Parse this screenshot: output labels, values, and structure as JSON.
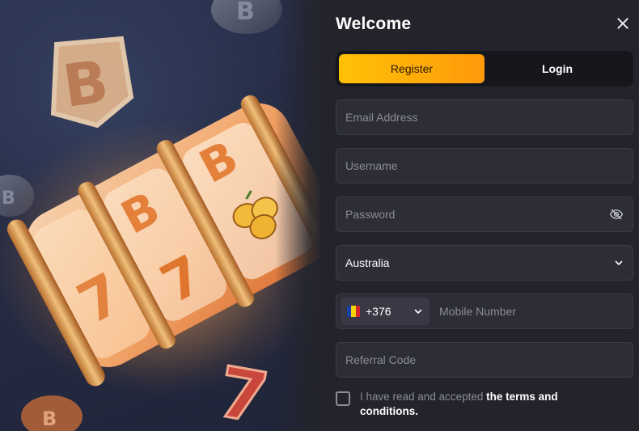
{
  "panel": {
    "title": "Welcome",
    "close_icon": "close-icon"
  },
  "tabs": [
    {
      "label": "Register",
      "active": true
    },
    {
      "label": "Login",
      "active": false
    }
  ],
  "form": {
    "email": {
      "placeholder": "Email Address",
      "value": ""
    },
    "username": {
      "placeholder": "Username",
      "value": ""
    },
    "password": {
      "placeholder": "Password",
      "value": "",
      "toggle_icon": "eye-off-icon"
    },
    "country": {
      "value": "Australia",
      "icon": "chevron-down-icon"
    },
    "phone": {
      "dial_code": "+376",
      "flag_colors": [
        "#1b3ea8",
        "#f5d20a",
        "#d7262b"
      ],
      "placeholder": "Mobile Number",
      "value": ""
    },
    "referral": {
      "placeholder": "Referral Code",
      "value": ""
    }
  },
  "terms": {
    "prefix": "I have read and accepted",
    "link": "the terms and conditions.",
    "checked": false
  },
  "colors": {
    "accent_start": "#ffc107",
    "accent_end": "#ff9a0a",
    "panel_bg": "#23242b",
    "input_bg": "#2c2d36"
  }
}
